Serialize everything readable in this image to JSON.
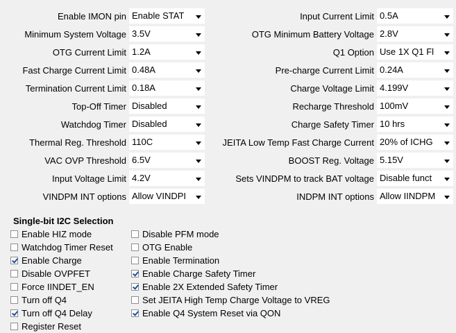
{
  "settings": {
    "left": [
      {
        "label": "Enable IMON pin",
        "value": "Enable STAT"
      },
      {
        "label": "Minimum System Voltage",
        "value": "3.5V"
      },
      {
        "label": "OTG Current Limit",
        "value": "1.2A"
      },
      {
        "label": "Fast Charge Current Limit",
        "value": "0.48A"
      },
      {
        "label": "Termination Current Limit",
        "value": "0.18A"
      },
      {
        "label": "Top-Off Timer",
        "value": "Disabled"
      },
      {
        "label": "Watchdog Timer",
        "value": "Disabled"
      },
      {
        "label": "Thermal Reg. Threshold",
        "value": "110C"
      },
      {
        "label": "VAC OVP Threshold",
        "value": "6.5V"
      },
      {
        "label": "Input Voltage Limit",
        "value": "4.2V"
      },
      {
        "label": "VINDPM INT options",
        "value": "Allow VINDPI"
      }
    ],
    "right": [
      {
        "label": "Input Current Limit",
        "value": "0.5A"
      },
      {
        "label": "OTG Minimum Battery Voltage",
        "value": "2.8V"
      },
      {
        "label": "Q1 Option",
        "value": "Use 1X Q1 Fl"
      },
      {
        "label": "Pre-charge Current Limit",
        "value": "0.24A"
      },
      {
        "label": "Charge Voltage Limit",
        "value": "4.199V"
      },
      {
        "label": "Recharge Threshold",
        "value": "100mV"
      },
      {
        "label": "Charge Safety Timer",
        "value": "10 hrs"
      },
      {
        "label": "JEITA Low Temp Fast Charge Current",
        "value": "20% of ICHG"
      },
      {
        "label": "BOOST Reg. Voltage",
        "value": "5.15V"
      },
      {
        "label": "Sets VINDPM to track BAT voltage",
        "value": "Disable funct"
      },
      {
        "label": "INDPM INT options",
        "value": "Allow IINDPM"
      }
    ]
  },
  "i2c": {
    "title": "Single-bit I2C Selection",
    "col_a": [
      {
        "label": "Enable HIZ mode",
        "checked": false
      },
      {
        "label": "Watchdog Timer Reset",
        "checked": false
      },
      {
        "label": "Enable Charge",
        "checked": true
      },
      {
        "label": "Disable OVPFET",
        "checked": false
      },
      {
        "label": "Force IINDET_EN",
        "checked": false
      },
      {
        "label": "Turn off Q4",
        "checked": false
      },
      {
        "label": "Turn off Q4 Delay",
        "checked": true
      },
      {
        "label": "Register Reset",
        "checked": false
      }
    ],
    "col_b": [
      {
        "label": "Disable PFM mode",
        "checked": false
      },
      {
        "label": "OTG Enable",
        "checked": false
      },
      {
        "label": "Enable Termination",
        "checked": false
      },
      {
        "label": "Enable Charge Safety Timer",
        "checked": true
      },
      {
        "label": "Enable 2X Extended Safety Timer",
        "checked": true
      },
      {
        "label": "Set JEITA High Temp Charge Voltage to VREG",
        "checked": false
      },
      {
        "label": "Enable Q4 System Reset via QON",
        "checked": true
      }
    ]
  },
  "colors": {
    "checkmark": "#1f4f9c",
    "background": "#f0f0f0"
  }
}
